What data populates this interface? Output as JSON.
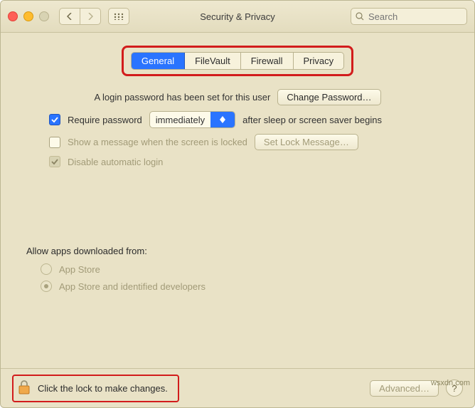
{
  "window": {
    "title": "Security & Privacy"
  },
  "search": {
    "placeholder": "Search"
  },
  "tabs": {
    "general": "General",
    "filevault": "FileVault",
    "firewall": "Firewall",
    "privacy": "Privacy"
  },
  "password_set": "A login password has been set for this user",
  "change_password": "Change Password…",
  "require_password": {
    "label": "Require password",
    "value": "immediately",
    "after": "after sleep or screen saver begins"
  },
  "show_message": "Show a message when the screen is locked",
  "set_lock_message": "Set Lock Message…",
  "disable_auto_login": "Disable automatic login",
  "allow_apps": {
    "label": "Allow apps downloaded from:",
    "opt1": "App Store",
    "opt2": "App Store and identified developers"
  },
  "lock_hint": "Click the lock to make changes.",
  "advanced": "Advanced…",
  "help": "?",
  "watermark": "wsxdn.com"
}
